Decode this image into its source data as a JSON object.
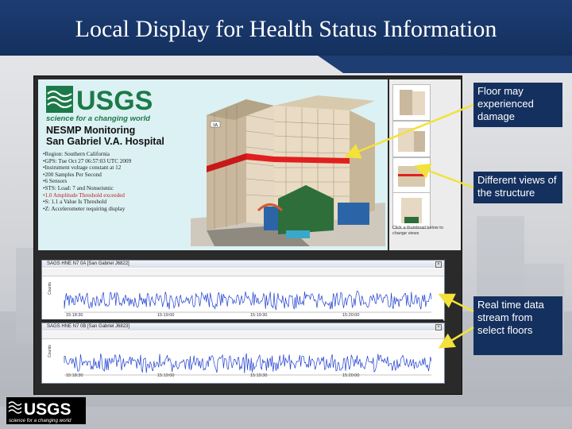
{
  "slide": {
    "title": "Local Display for Health Status Information"
  },
  "logo": {
    "brand": "USGS",
    "tagline": "science for a changing world"
  },
  "monitor": {
    "title_line1": "NESMP Monitoring",
    "title_line2": "San Gabriel V.A. Hospital",
    "info_items": [
      {
        "text": "Region: Southern California",
        "highlight": false
      },
      {
        "text": "GPS: Tue Oct 27 06:57:03 UTC 2009",
        "highlight": false
      },
      {
        "text": "Instrument voltage constant at 12",
        "highlight": false
      },
      {
        "text": "200 Samples Per Second",
        "highlight": false
      },
      {
        "text": "6 Sensors",
        "highlight": false
      },
      {
        "text": "STS: Load: 7 and Nonseismic",
        "highlight": false
      },
      {
        "text": "1.0 Amplitude Threshold exceeded",
        "highlight": true
      },
      {
        "text": "S: 1.1 a Value Is Threshold",
        "highlight": false
      },
      {
        "text": "Z: Accelerometer requiring display",
        "highlight": false
      }
    ],
    "thumbnail_caption": "Click a thumbnail below to change views",
    "building_sign": "VA"
  },
  "waveforms": [
    {
      "title": "SAGS HNE N7 0A  [San Gabriel J6822]",
      "ticks": [
        "15:18:30",
        "15:19:00",
        "15:19:30",
        "15:20:00"
      ],
      "close_glyph": "×",
      "y_label": "Counts"
    },
    {
      "title": "SAGS HNE N7 0B  [San Gabriel J6823]",
      "ticks": [
        "15:18:30",
        "15:19:00",
        "15:19:30",
        "15:20:00"
      ],
      "close_glyph": "×",
      "y_label": "Counts"
    }
  ],
  "callouts": [
    {
      "text": "Floor may experienced damage"
    },
    {
      "text": "Different views of the structure"
    },
    {
      "text": "Real time data stream from select floors"
    }
  ],
  "colors": {
    "header_blue": "#1d3d73",
    "callout_blue": "#14305e",
    "wave_blue": "#1f3fcf",
    "arrow_yellow": "#f2e23a",
    "highlight_red": "#e02020",
    "usgs_green": "#1b7a48"
  },
  "icons": [
    "usgs-logo-icon",
    "close-icon",
    "arrow-icon"
  ]
}
